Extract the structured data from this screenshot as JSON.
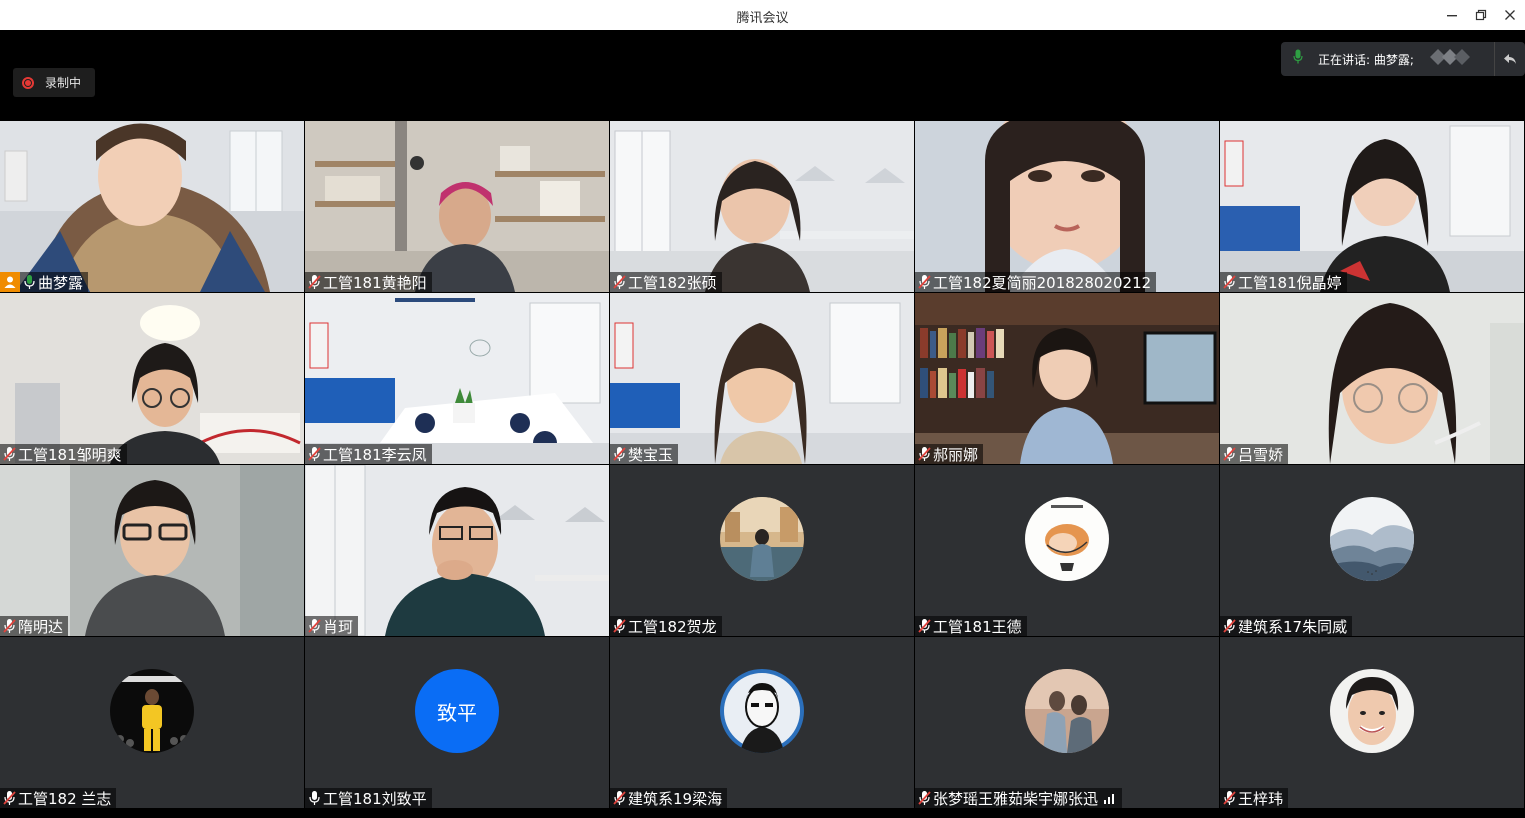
{
  "window": {
    "title": "腾讯会议"
  },
  "recording": {
    "label": "录制中"
  },
  "speaking": {
    "label": "正在讲话: 曲梦露;"
  },
  "colors": {
    "muted_mic": "#e0443e",
    "active_mic": "#2ea043",
    "avatar_blue": "#0a6df5",
    "tile_bg": "#2e3033",
    "host_badge": "#f08c00"
  },
  "participants": [
    {
      "name": "曲梦露",
      "mic": "active",
      "host": true,
      "type": "video"
    },
    {
      "name": "工管181黄艳阳",
      "mic": "muted",
      "type": "video"
    },
    {
      "name": "工管182张硕",
      "mic": "muted",
      "type": "video"
    },
    {
      "name": "工管182夏简丽201828020212",
      "mic": "muted",
      "type": "video"
    },
    {
      "name": "工管181倪晶婷",
      "mic": "muted",
      "type": "video"
    },
    {
      "name": "工管181邹明爽",
      "mic": "muted",
      "type": "video"
    },
    {
      "name": "工管181李云凤",
      "mic": "muted",
      "type": "video"
    },
    {
      "name": "樊宝玉",
      "mic": "muted",
      "type": "video"
    },
    {
      "name": "郝丽娜",
      "mic": "muted",
      "type": "video"
    },
    {
      "name": "吕雪娇",
      "mic": "muted",
      "type": "video"
    },
    {
      "name": "隋明达",
      "mic": "muted",
      "type": "video"
    },
    {
      "name": "肖珂",
      "mic": "muted",
      "type": "video"
    },
    {
      "name": "工管182贺龙",
      "mic": "muted",
      "type": "avatar"
    },
    {
      "name": "工管181王德",
      "mic": "muted",
      "type": "avatar"
    },
    {
      "name": "建筑系17朱同威",
      "mic": "muted",
      "type": "avatar"
    },
    {
      "name": "工管182 兰志",
      "mic": "muted",
      "type": "avatar"
    },
    {
      "name": "工管181刘致平",
      "mic": "on",
      "type": "avatar",
      "avatar_text": "致平"
    },
    {
      "name": "建筑系19梁海",
      "mic": "muted",
      "type": "avatar"
    },
    {
      "name": "张梦瑶王雅茹柴宇娜张迅",
      "mic": "muted",
      "type": "avatar",
      "signal": true
    },
    {
      "name": "王梓玮",
      "mic": "muted",
      "type": "avatar"
    }
  ]
}
